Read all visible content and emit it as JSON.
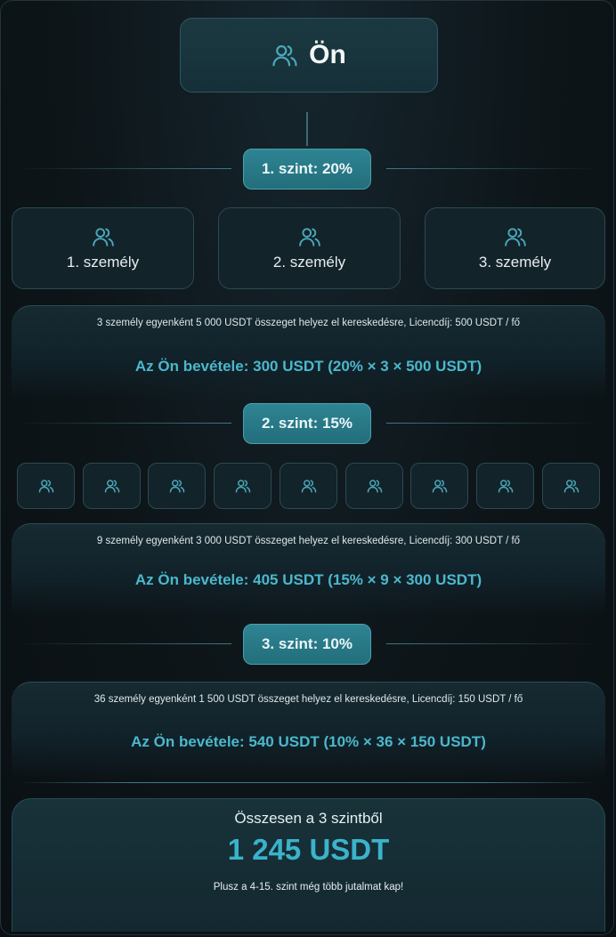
{
  "root": {
    "label": "Ön",
    "icon": "users-icon"
  },
  "levels": [
    {
      "badge": "1. szint: 20%",
      "people": [
        "1. személy",
        "2. személy",
        "3. személy"
      ],
      "description": "3 személy egyenként 5 000 USDT összeget helyez el kereskedésre, Licencdíj: 500 USDT / fő",
      "income": "Az Ön bevétele: 300 USDT (20% × 3 × 500 USDT)"
    },
    {
      "badge": "2. szint: 15%",
      "people_count": 9,
      "description": "9 személy egyenként 3 000 USDT összeget helyez el kereskedésre, Licencdíj: 300 USDT / fő",
      "income": "Az Ön bevétele: 405 USDT (15% × 9 × 300 USDT)"
    },
    {
      "badge": "3. szint: 10%",
      "description": "36 személy egyenként 1 500 USDT összeget helyez el kereskedésre, Licencdíj: 150 USDT / fő",
      "income": "Az Ön bevétele: 540 USDT (10% × 36 × 150 USDT)"
    }
  ],
  "total": {
    "caption": "Összesen a 3 szintből",
    "value": "1 245 USDT",
    "note": "Plusz a 4-15. szint még több jutalmat kap!"
  },
  "colors": {
    "accent": "#3ab3cb",
    "income_text": "#4bb8cc",
    "badge_bg": "#2a7c8a",
    "icon": "#4aa8ba",
    "background": "#0d1519"
  }
}
